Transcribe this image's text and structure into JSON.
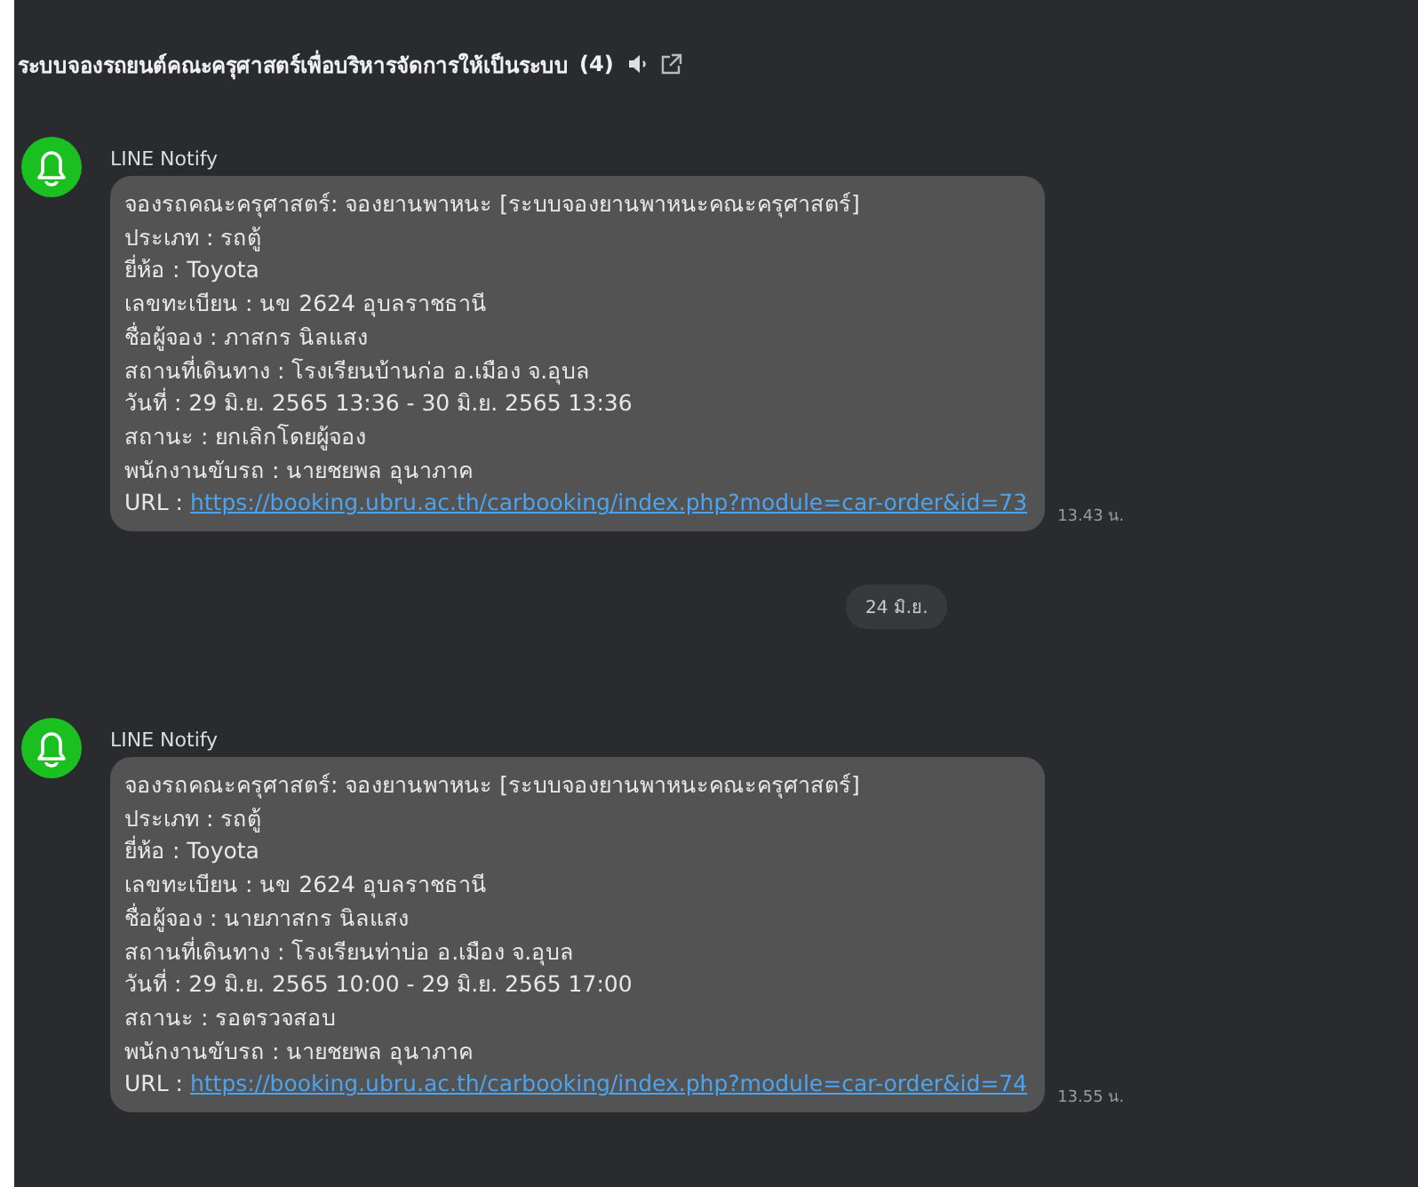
{
  "header": {
    "title": "ระบบจองรถยนต์คณะครุศาสตร์เพื่อบริหารจัดการให้เป็นระบบ",
    "count": "(4)"
  },
  "items": [
    {
      "kind": "message",
      "sender": "LINE Notify",
      "lines": [
        "จองรถคณะครุศาสตร์: จองยานพาหนะ [ระบบจองยานพาหนะคณะครุศาสตร์]",
        "ประเภท : รถตู้",
        "ยี่ห้อ : Toyota",
        "เลขทะเบียน : นข 2624 อุบลราชธานี",
        "ชื่อผู้จอง : ภาสกร นิลแสง",
        "สถานที่เดินทาง : โรงเรียนบ้านก่อ อ.เมือง จ.อุบล",
        "วันที่ : 29 มิ.ย. 2565 13:36 - 30 มิ.ย. 2565 13:36",
        "สถานะ : ยกเลิกโดยผู้จอง",
        "พนักงานขับรถ : นายชยพล อุนาภาค"
      ],
      "url_label": "URL :",
      "url": "https://booking.ubru.ac.th/carbooking/index.php?module=car-order&id=73",
      "time": "13.43 น."
    },
    {
      "kind": "date",
      "text": "24 มิ.ย."
    },
    {
      "kind": "message",
      "sender": "LINE Notify",
      "lines": [
        "จองรถคณะครุศาสตร์: จองยานพาหนะ [ระบบจองยานพาหนะคณะครุศาสตร์]",
        "ประเภท : รถตู้",
        "ยี่ห้อ : Toyota",
        "เลขทะเบียน : นข 2624 อุบลราชธานี",
        "ชื่อผู้จอง : นายภาสกร นิลแสง",
        "สถานที่เดินทาง : โรงเรียนท่าบ่อ อ.เมือง จ.อุบล",
        "วันที่ : 29 มิ.ย. 2565 10:00 - 29 มิ.ย. 2565 17:00",
        "สถานะ : รอตรวจสอบ",
        "พนักงานขับรถ : นายชยพล อุนาภาค"
      ],
      "url_label": "URL :",
      "url": "https://booking.ubru.ac.th/carbooking/index.php?module=car-order&id=74",
      "time": "13.55 น."
    }
  ]
}
